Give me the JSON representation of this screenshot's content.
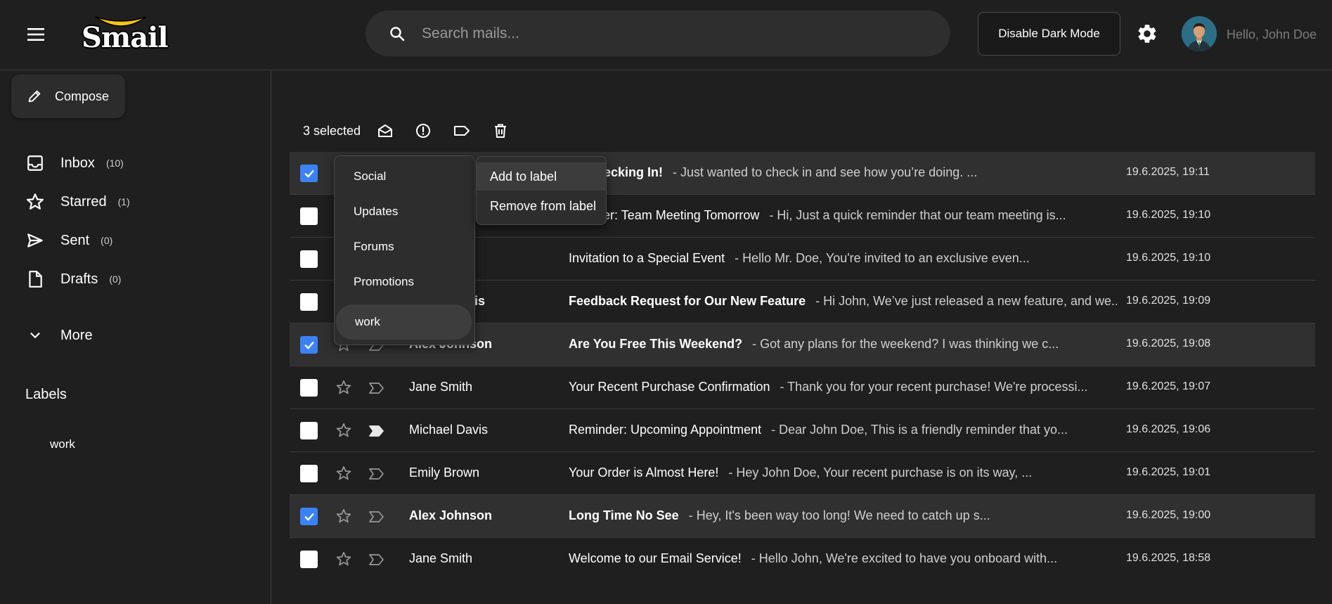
{
  "header": {
    "logo_text": "Smail",
    "search_placeholder": "Search mails...",
    "dark_mode_label": "Disable Dark Mode",
    "greeting": "Hello, John Doe"
  },
  "sidebar": {
    "compose_label": "Compose",
    "nav": [
      {
        "label": "Inbox",
        "count": "(10)",
        "icon": "inbox-icon"
      },
      {
        "label": "Starred",
        "count": "(1)",
        "icon": "star-icon"
      },
      {
        "label": "Sent",
        "count": "(0)",
        "icon": "send-icon"
      },
      {
        "label": "Drafts",
        "count": "(0)",
        "icon": "draft-icon"
      }
    ],
    "more_label": "More",
    "labels_title": "Labels",
    "labels": [
      "work"
    ]
  },
  "toolbar": {
    "selected_text": "3 selected"
  },
  "label_menu": {
    "items": [
      "Social",
      "Updates",
      "Forums",
      "Promotions",
      "work"
    ],
    "active": "work"
  },
  "action_menu": {
    "items": [
      "Add to label",
      "Remove from label"
    ],
    "active": "Add to label"
  },
  "mails": [
    {
      "sender": "",
      "subject": "Checking In!",
      "preview": "- Just wanted to check in and see how you’re doing. ...",
      "date": "19.6.2025, 19:11",
      "checked": true,
      "unread": true,
      "starred": false,
      "labeled": false
    },
    {
      "sender": "",
      "subject": "Reminder: Team Meeting Tomorrow",
      "preview": "- Hi, Just a quick reminder that our team meeting is...",
      "date": "19.6.2025, 19:10",
      "checked": false,
      "unread": false,
      "starred": false,
      "labeled": false
    },
    {
      "sender": "",
      "subject": "Invitation to a Special Event",
      "preview": "- Hello Mr. Doe, You're invited to an exclusive even...",
      "date": "19.6.2025, 19:10",
      "checked": false,
      "unread": false,
      "starred": false,
      "labeled": false
    },
    {
      "sender": "is",
      "subject": "Feedback Request for Our New Feature",
      "preview": "- Hi John, We’ve just released a new feature, and we...",
      "date": "19.6.2025, 19:09",
      "checked": false,
      "unread": true,
      "starred": false,
      "labeled": false
    },
    {
      "sender": "Alex Johnson",
      "subject": "Are You Free This Weekend?",
      "preview": "- Got any plans for the weekend? I was thinking we c...",
      "date": "19.6.2025, 19:08",
      "checked": true,
      "unread": true,
      "starred": false,
      "labeled": false
    },
    {
      "sender": "Jane Smith",
      "subject": "Your Recent Purchase Confirmation",
      "preview": "- Thank you for your recent purchase! We're processi...",
      "date": "19.6.2025, 19:07",
      "checked": false,
      "unread": false,
      "starred": false,
      "labeled": false
    },
    {
      "sender": "Michael Davis",
      "subject": "Reminder: Upcoming Appointment",
      "preview": "- Dear John Doe, This is a friendly reminder that yo...",
      "date": "19.6.2025, 19:06",
      "checked": false,
      "unread": false,
      "starred": false,
      "labeled": true
    },
    {
      "sender": "Emily Brown",
      "subject": "Your Order is Almost Here!",
      "preview": "- Hey John Doe, Your recent purchase is on its way, ...",
      "date": "19.6.2025, 19:01",
      "checked": false,
      "unread": false,
      "starred": false,
      "labeled": false
    },
    {
      "sender": "Alex Johnson",
      "subject": "Long Time No See",
      "preview": "- Hey, It's been way too long! We need to catch up s...",
      "date": "19.6.2025, 19:00",
      "checked": true,
      "unread": true,
      "starred": false,
      "labeled": false
    },
    {
      "sender": "Jane Smith",
      "subject": "Welcome to our Email Service!",
      "preview": "- Hello John, We're excited to have you onboard with...",
      "date": "19.6.2025, 18:58",
      "checked": false,
      "unread": false,
      "starred": false,
      "labeled": false
    }
  ],
  "colors": {
    "background": "#1f1f1f",
    "checkbox_checked": "#3b82f6"
  }
}
